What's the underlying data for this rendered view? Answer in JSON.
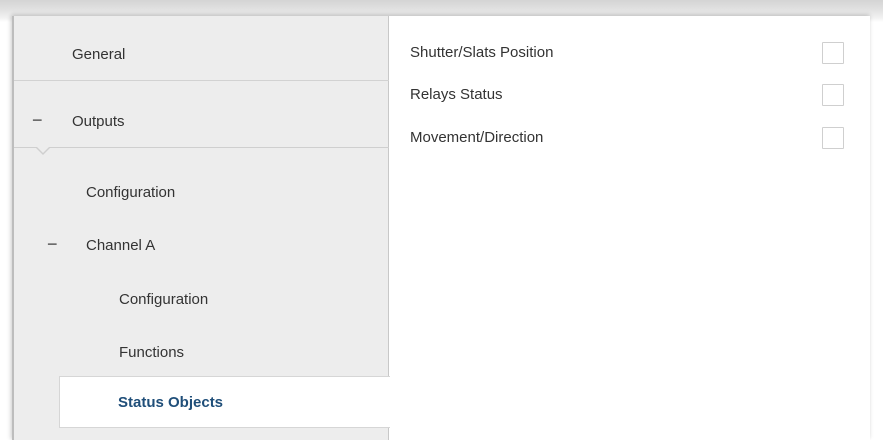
{
  "sidebar": {
    "general_label": "General",
    "outputs_label": "Outputs",
    "outputs_toggle": "−",
    "configuration_label": "Configuration",
    "channel_a_label": "Channel A",
    "channel_a_toggle": "−",
    "channel_configuration_label": "Configuration",
    "functions_label": "Functions",
    "status_objects_label": "Status Objects"
  },
  "main": {
    "options": [
      {
        "label": "Shutter/Slats Position",
        "checked": false
      },
      {
        "label": "Relays Status",
        "checked": false
      },
      {
        "label": "Movement/Direction",
        "checked": false
      }
    ]
  },
  "colors": {
    "selected_text": "#1f4e79",
    "sidebar_bg": "#ededed",
    "text": "#333333"
  }
}
